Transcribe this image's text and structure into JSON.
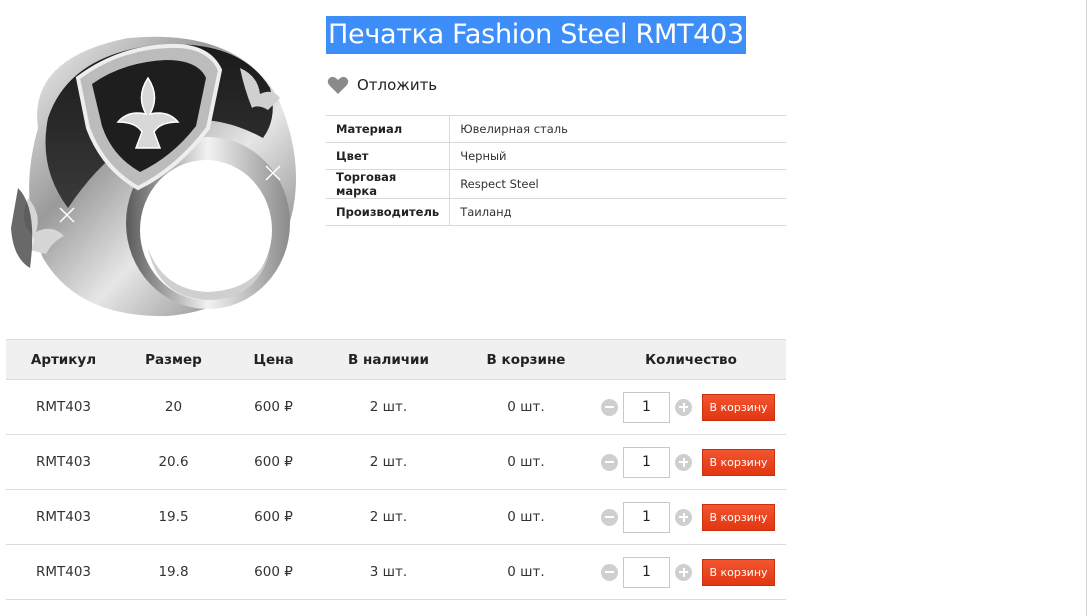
{
  "product": {
    "title": "Печатка Fashion Steel RMT403",
    "wishlist_label": "Отложить",
    "image_alt": "ring-photo"
  },
  "specs": [
    {
      "key": "Материал",
      "value": "Ювелирная сталь"
    },
    {
      "key": "Цвет",
      "value": "Черный"
    },
    {
      "key": "Торговая марка",
      "value": "Respect Steel"
    },
    {
      "key": "Производитель",
      "value": "Таиланд"
    }
  ],
  "stock": {
    "headers": {
      "article": "Артикул",
      "size": "Размер",
      "price": "Цена",
      "available": "В наличии",
      "in_cart": "В корзине",
      "quantity": "Количество"
    },
    "button_label": "В корзину",
    "rows": [
      {
        "article": "RMT403",
        "size": "20",
        "price": "600 ₽",
        "available": "2 шт.",
        "in_cart": "0 шт.",
        "qty": "1"
      },
      {
        "article": "RMT403",
        "size": "20.6",
        "price": "600 ₽",
        "available": "2 шт.",
        "in_cart": "0 шт.",
        "qty": "1"
      },
      {
        "article": "RMT403",
        "size": "19.5",
        "price": "600 ₽",
        "available": "2 шт.",
        "in_cart": "0 шт.",
        "qty": "1"
      },
      {
        "article": "RMT403",
        "size": "19.8",
        "price": "600 ₽",
        "available": "3 шт.",
        "in_cart": "0 шт.",
        "qty": "1"
      }
    ]
  },
  "colors": {
    "title_highlight": "#3d8ef8",
    "cart_button": "#e8401b",
    "heart_icon": "#8a8a8a",
    "qty_button": "#cfcfcf"
  }
}
